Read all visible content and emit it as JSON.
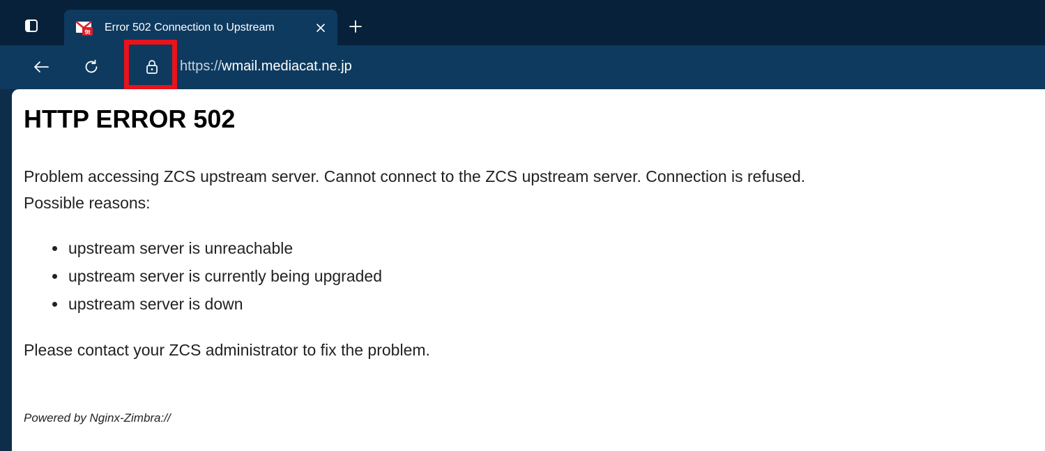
{
  "browser": {
    "tab": {
      "title": "Error 502 Connection to Upstream",
      "favicon": "zimbra-mail-icon"
    },
    "address_bar": {
      "scheme": "https://",
      "host": "wmail.mediacat.ne.jp"
    },
    "colors": {
      "tabstrip": "#08213a",
      "toolbar": "#0e3a5f",
      "highlight": "#e8131b"
    }
  },
  "page": {
    "heading": "HTTP ERROR 502",
    "description": "Problem accessing ZCS upstream server. Cannot connect to the ZCS upstream server. Connection is refused.",
    "reasons_intro": "Possible reasons:",
    "reasons": [
      "upstream server is unreachable",
      "upstream server is currently being upgraded",
      "upstream server is down"
    ],
    "contact": "Please contact your ZCS administrator to fix the problem.",
    "footer": "Powered by Nginx-Zimbra://"
  }
}
